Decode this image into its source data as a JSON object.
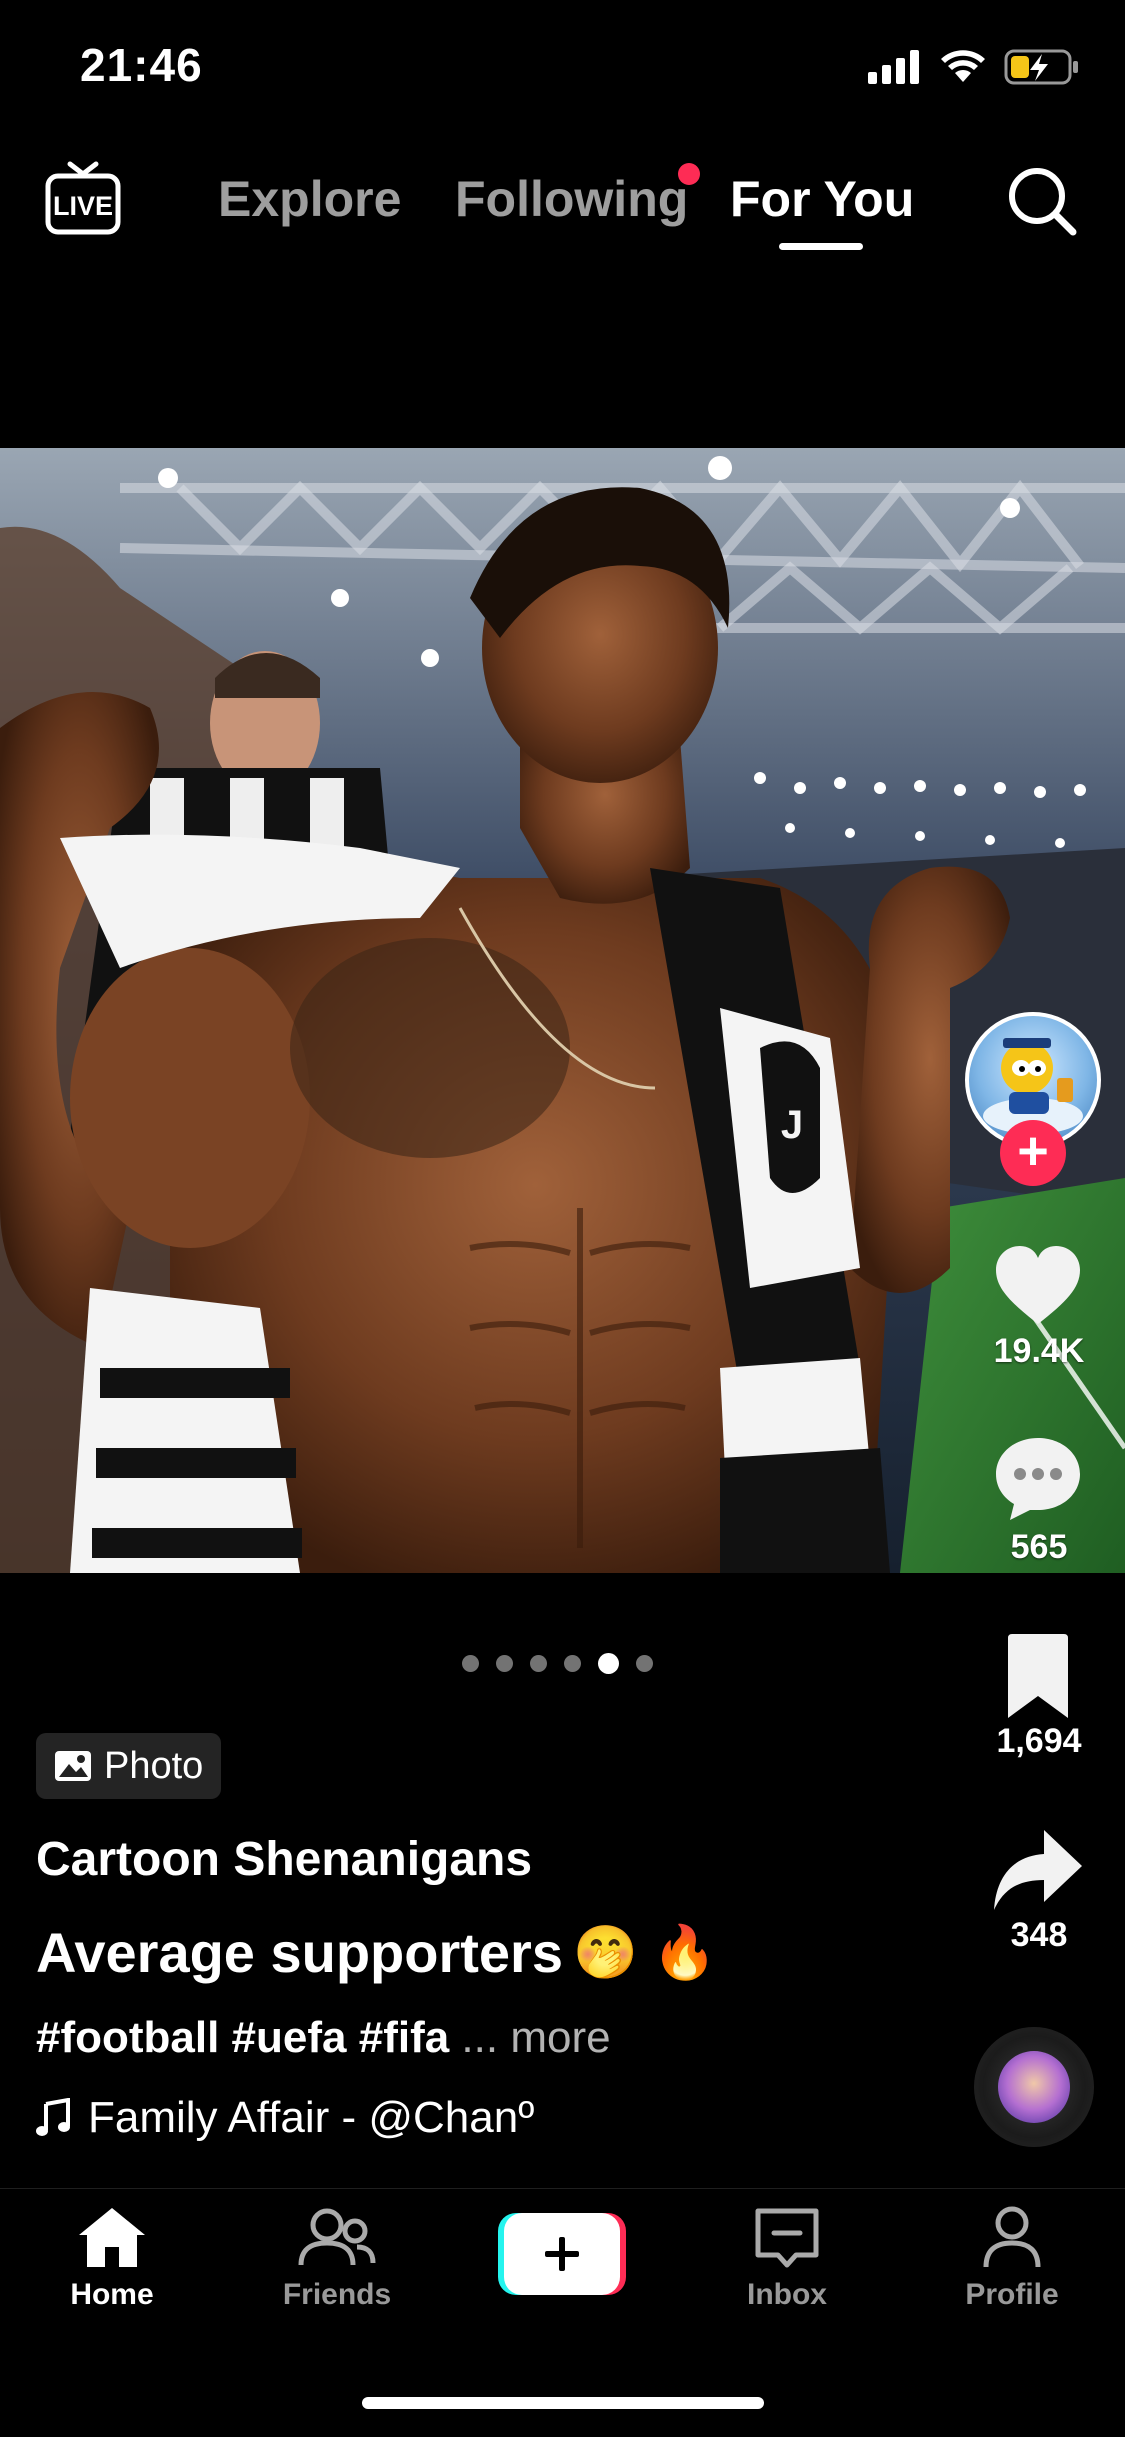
{
  "status_bar": {
    "time": "21:46"
  },
  "top_nav": {
    "live_icon": "live-tv-icon",
    "tabs": [
      {
        "label": "Explore",
        "active": false
      },
      {
        "label": "Following",
        "active": false,
        "has_notification_dot": true
      },
      {
        "label": "For You",
        "active": true
      }
    ],
    "search_icon": "search-icon"
  },
  "post": {
    "image_alt": "Muscular supporter in a Juventus scarf in a stadium crowd",
    "likes": "19.4K",
    "comments": "565",
    "bookmarks": "1,694",
    "shares": "348",
    "carousel": {
      "total": 6,
      "active_index": 4
    },
    "badge_label": "Photo",
    "author": "Cartoon Shenanigans",
    "title": "Average supporters",
    "title_emoji": "🤭 🔥",
    "hashtags": "#football #uefa #fifa",
    "more_label": "... more",
    "music": "Family Affair - @Chanº"
  },
  "bottom_nav": {
    "items": [
      {
        "label": "Home",
        "icon": "home-icon",
        "active": true
      },
      {
        "label": "Friends",
        "icon": "friends-icon",
        "active": false
      },
      {
        "label": "",
        "icon": "create-plus-icon",
        "active": false
      },
      {
        "label": "Inbox",
        "icon": "inbox-icon",
        "active": false
      },
      {
        "label": "Profile",
        "icon": "profile-icon",
        "active": false
      }
    ]
  },
  "colors": {
    "accent_red": "#fe2c55",
    "accent_cyan": "#25f4ee",
    "background": "#000000"
  }
}
